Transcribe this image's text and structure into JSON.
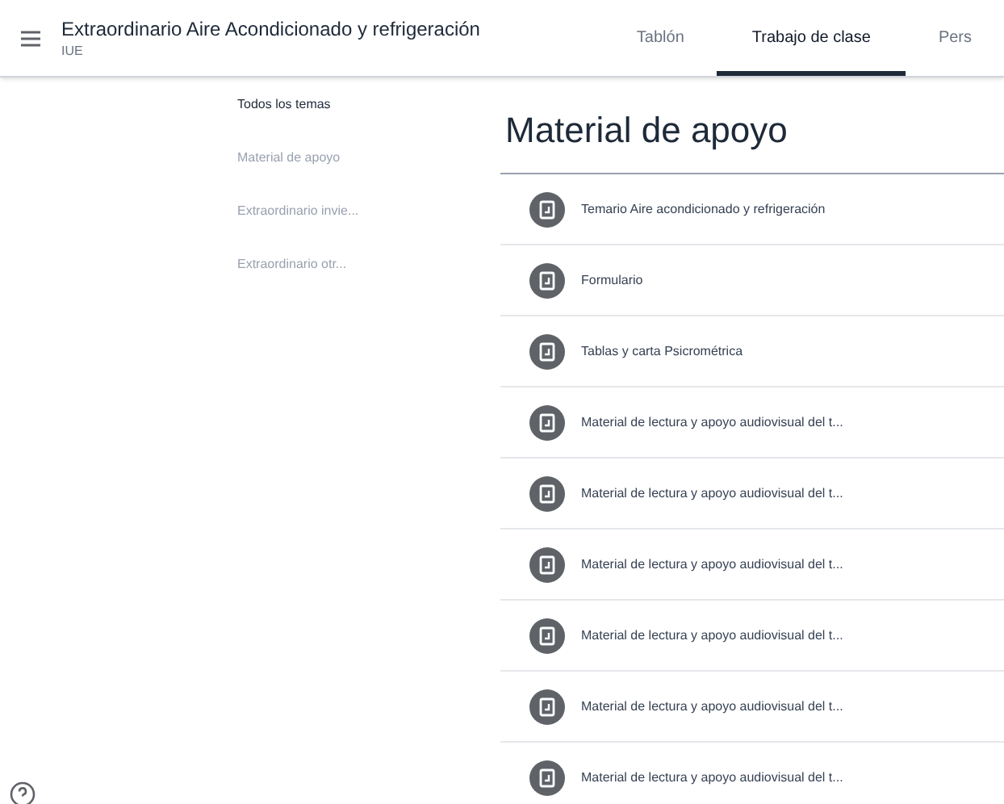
{
  "header": {
    "title": "Extraordinario Aire Acondicionado y refrigeración",
    "subtitle": "IUE"
  },
  "tabs": [
    {
      "label": "Tablón",
      "selected": false
    },
    {
      "label": "Trabajo de clase",
      "selected": true
    },
    {
      "label": "Pers",
      "selected": false
    }
  ],
  "sidebar": {
    "items": [
      {
        "label": "Todos los temas",
        "selected": true
      },
      {
        "label": "Material de apoyo",
        "selected": false
      },
      {
        "label": "Extraordinario invie...",
        "selected": false
      },
      {
        "label": "Extraordinario otr...",
        "selected": false
      }
    ]
  },
  "section": {
    "title": "Material de apoyo",
    "items": [
      {
        "title": "Temario Aire acondicionado y refrigeración"
      },
      {
        "title": "Formulario"
      },
      {
        "title": "Tablas y carta Psicrométrica"
      },
      {
        "title": "Material de lectura y apoyo audiovisual del t..."
      },
      {
        "title": "Material de lectura y apoyo audiovisual del t..."
      },
      {
        "title": "Material de lectura y apoyo audiovisual del t..."
      },
      {
        "title": "Material de lectura y apoyo audiovisual del t..."
      },
      {
        "title": "Material de lectura y apoyo audiovisual del t..."
      },
      {
        "title": "Material de lectura y apoyo audiovisual del t..."
      }
    ]
  }
}
